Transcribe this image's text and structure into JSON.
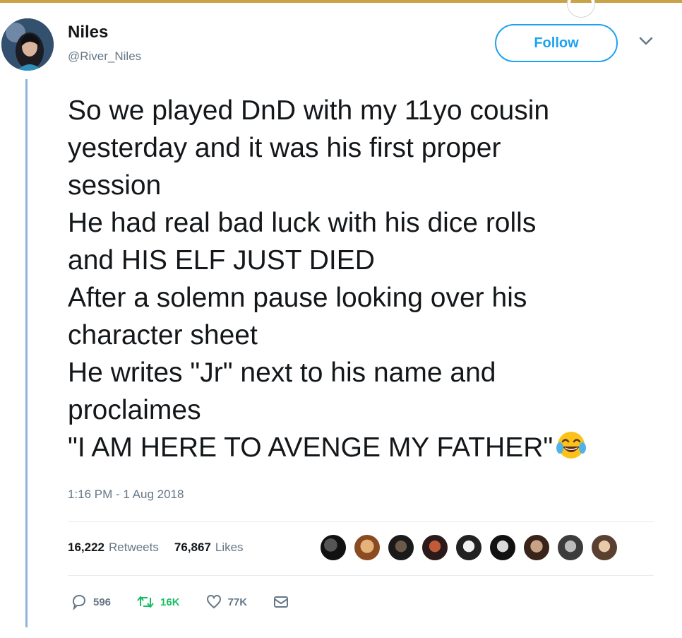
{
  "author": {
    "name": "Niles",
    "handle": "@River_Niles"
  },
  "follow_label": "Follow",
  "tweet_lines": [
    "So we played DnD with my 11yo cousin",
    "yesterday and it was his first proper",
    "session",
    "He had real bad luck with his dice rolls",
    "and HIS ELF JUST DIED",
    "After a solemn pause looking over his",
    "character sheet",
    "He writes \"Jr\" next to his name and",
    "proclaimes",
    "\"I AM HERE TO AVENGE MY FATHER\""
  ],
  "timestamp": "1:16 PM - 1 Aug 2018",
  "stats": {
    "retweets_count": "16,222",
    "retweets_label": "Retweets",
    "likes_count": "76,867",
    "likes_label": "Likes"
  },
  "actions": {
    "replies": "596",
    "retweets": "16K",
    "likes": "77K"
  },
  "colors": {
    "accent": "#1da1f2",
    "retweet_green": "#17bf63",
    "muted_text": "#657786",
    "thread_line": "#8fb4d6"
  },
  "icons": [
    "reply-icon",
    "retweet-icon",
    "like-heart-icon",
    "direct-message-icon",
    "chevron-down-icon",
    "laughing-tears-emoji"
  ]
}
